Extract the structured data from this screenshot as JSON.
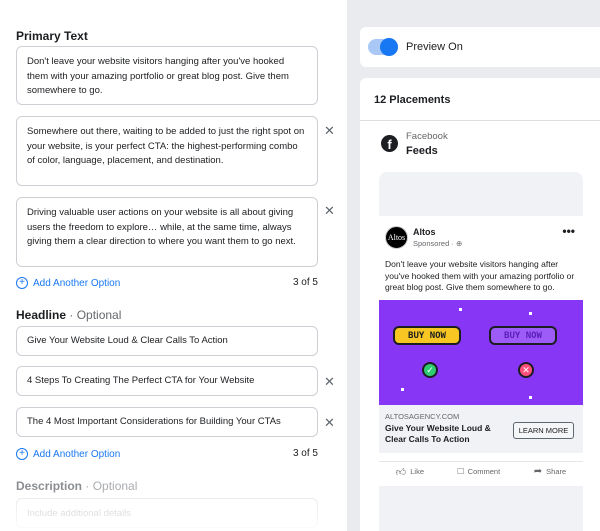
{
  "primary_text": {
    "title": "Primary Text",
    "options": [
      "Don't leave your website visitors hanging after you've hooked them with your amazing portfolio or great blog post. Give them somewhere to go.",
      "Somewhere out there, waiting to be added to just the right spot on your website, is your perfect CTA: the highest-performing combo of color, language, placement, and destination.",
      "Driving valuable user actions on your website is all about giving users the freedom to explore… while, at the same time, always giving them a clear direction to where you want them to go next."
    ],
    "add_label": "Add Another Option",
    "count": "3 of 5"
  },
  "headline": {
    "title": "Headline",
    "optional": "· Optional",
    "options": [
      "Give Your Website Loud & Clear Calls To Action",
      "4 Steps To Creating The Perfect CTA for Your Website",
      "The 4 Most Important Considerations for Building Your CTAs"
    ],
    "add_label": "Add Another Option",
    "count": "3 of 5"
  },
  "description": {
    "title": "Description",
    "optional": "· Optional",
    "placeholder": "Include additional details"
  },
  "preview": {
    "toggle_label": "Preview On",
    "toggle_on": true,
    "placements_title": "12 Placements",
    "platform": "Facebook",
    "placement": "Feeds"
  },
  "post": {
    "avatar_text": "Altos",
    "name": "Altos",
    "sponsored": "Sponsored · ⊕",
    "more": "•••",
    "text": "Don't leave your website visitors hanging after you've hooked them with your amazing portfolio or great blog post. Give them somewhere to go.",
    "creative_button_1": "BUY NOW",
    "creative_button_2": "BUY NOW",
    "check_glyph": "✓",
    "x_glyph": "✕",
    "link_domain": "ALTOSAGENCY.COM",
    "link_title": "Give Your Website Loud & Clear Calls To Action",
    "cta": "LEARN MORE",
    "actions": [
      "Like",
      "Comment",
      "Share"
    ]
  },
  "icons": {
    "close_glyph": "✕",
    "plus_glyph": "+"
  },
  "colors": {
    "accent": "#1877f2",
    "creative_bg": "#8736f5",
    "buy_now": "#f7c622"
  }
}
